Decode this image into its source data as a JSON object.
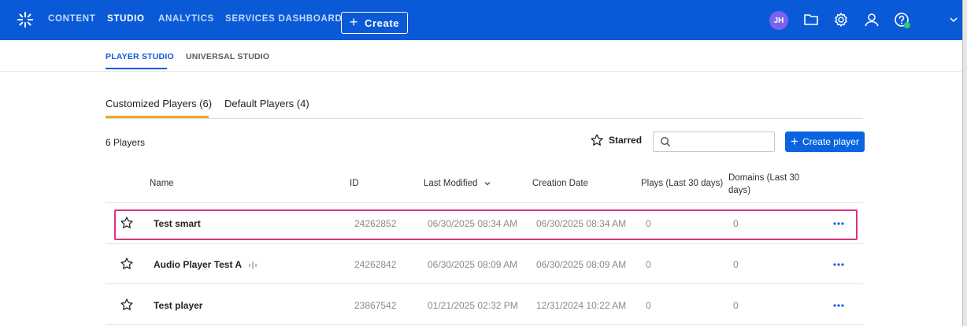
{
  "top_nav": {
    "items": [
      {
        "label": "CONTENT",
        "active": false
      },
      {
        "label": "STUDIO",
        "active": true
      },
      {
        "label": "ANALYTICS",
        "active": false
      },
      {
        "label": "SERVICES DASHBOARD",
        "active": false
      }
    ],
    "create_label": "Create",
    "icons": [
      "folder-icon",
      "gear-icon",
      "user-icon",
      "help-icon"
    ],
    "avatar_initials": "JH"
  },
  "sub_nav": {
    "items": [
      {
        "label": "PLAYER STUDIO",
        "active": true
      },
      {
        "label": "UNIVERSAL STUDIO",
        "active": false
      }
    ]
  },
  "tabs": [
    {
      "label": "Customized Players (6)",
      "active": true
    },
    {
      "label": "Default Players (4)",
      "active": false
    }
  ],
  "toolbar": {
    "count_label": "6 Players",
    "starred_label": "Starred",
    "search_placeholder": "",
    "create_player_label": "Create player"
  },
  "table": {
    "columns": {
      "name": "Name",
      "id": "ID",
      "last_modified": "Last Modified",
      "creation_date": "Creation Date",
      "plays": "Plays (Last 30 days)",
      "domains": "Domains (Last 30 days)"
    },
    "rows": [
      {
        "name": "Test smart",
        "id": "24262852",
        "last_modified": "06/30/2025 08:34 AM",
        "creation_date": "06/30/2025 08:34 AM",
        "plays": "0",
        "domains": "0",
        "audio": false,
        "highlighted": true
      },
      {
        "name": "Audio Player Test A",
        "id": "24262842",
        "last_modified": "06/30/2025 08:09 AM",
        "creation_date": "06/30/2025 08:09 AM",
        "plays": "0",
        "domains": "0",
        "audio": true,
        "highlighted": false
      },
      {
        "name": "Test player",
        "id": "23867542",
        "last_modified": "01/21/2025 02:32 PM",
        "creation_date": "12/31/2024 10:22 AM",
        "plays": "0",
        "domains": "0",
        "audio": false,
        "highlighted": false
      }
    ]
  },
  "colors": {
    "brand_blue": "#0a5ad8",
    "tab_accent": "#f2a81d",
    "highlight": "#d8337f",
    "avatar": "#7a63ee",
    "status_dot": "#2ecc71"
  }
}
